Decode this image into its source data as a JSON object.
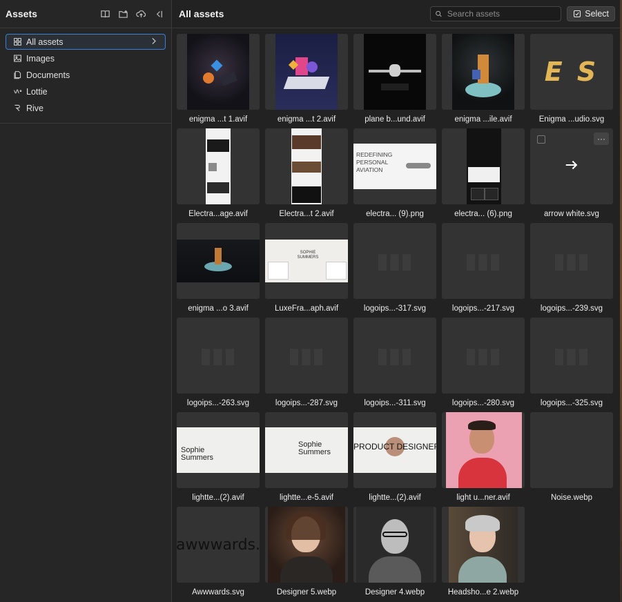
{
  "sidebar": {
    "title": "Assets",
    "items": [
      {
        "label": "All assets",
        "icon": "grid-icon",
        "active": true
      },
      {
        "label": "Images",
        "icon": "image-icon"
      },
      {
        "label": "Documents",
        "icon": "documents-icon"
      },
      {
        "label": "Lottie",
        "icon": "lottie-icon"
      },
      {
        "label": "Rive",
        "icon": "rive-icon"
      }
    ]
  },
  "main": {
    "title": "All assets",
    "search_placeholder": "Search assets",
    "select_label": "Select"
  },
  "assets": [
    {
      "name": "enigma ...t 1.avif"
    },
    {
      "name": "enigma ...t 2.avif"
    },
    {
      "name": "plane b...und.avif"
    },
    {
      "name": "enigma ...ile.avif"
    },
    {
      "name": "Enigma ...udio.svg",
      "text": "E S"
    },
    {
      "name": "Electra...age.avif"
    },
    {
      "name": "Electra...t 2.avif"
    },
    {
      "name": "electra... (9).png",
      "text": "REDEFINING PERSONAL AVIATION"
    },
    {
      "name": "electra... (6).png"
    },
    {
      "name": "arrow white.svg",
      "icon": "arrow-right-icon"
    },
    {
      "name": "enigma ...o 3.avif"
    },
    {
      "name": "LuxeFra...aph.avif",
      "text": "SOPHIE SUMMERS"
    },
    {
      "name": "logoips...-317.svg"
    },
    {
      "name": "logoips...-217.svg"
    },
    {
      "name": "logoips...-239.svg"
    },
    {
      "name": "logoips...-263.svg"
    },
    {
      "name": "logoips...-287.svg"
    },
    {
      "name": "logoips...-311.svg"
    },
    {
      "name": "logoips...-280.svg"
    },
    {
      "name": "logoips...-325.svg"
    },
    {
      "name": "lightte...(2).avif",
      "text": "Sophie Summers"
    },
    {
      "name": "lightte...e-5.avif",
      "text": "Sophie Summers"
    },
    {
      "name": "lightte...(2).avif",
      "text": "PRODUCT DESIGNER"
    },
    {
      "name": "light u...ner.avif"
    },
    {
      "name": "Noise.webp"
    },
    {
      "name": "Awwwards.svg",
      "text": "awwwards."
    },
    {
      "name": "Designer 5.webp"
    },
    {
      "name": "Designer 4.webp"
    },
    {
      "name": "Headsho...e 2.webp"
    }
  ]
}
